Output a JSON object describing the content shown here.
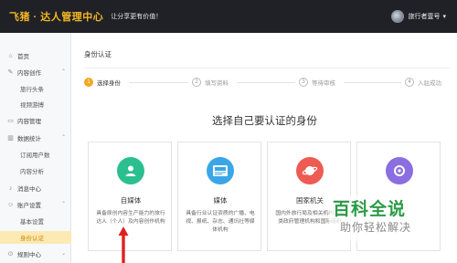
{
  "topbar": {
    "brand": "飞猪 · 达人管理中心",
    "slogan": "让分享更有价值！",
    "username": "旅行者壹号",
    "brand_color": "#f5b623",
    "bg_color": "#1f2127"
  },
  "sidebar": {
    "items": [
      {
        "label": "首页",
        "type": "group",
        "icon": "home-icon"
      },
      {
        "label": "内容创作",
        "type": "group",
        "icon": "edit-icon"
      },
      {
        "label": "旅行头条",
        "type": "child"
      },
      {
        "label": "视频游搏",
        "type": "child"
      },
      {
        "label": "内容管理",
        "type": "group",
        "icon": "folder-icon"
      },
      {
        "label": "数据统计",
        "type": "group",
        "icon": "chart-icon"
      },
      {
        "label": "订阅用户数",
        "type": "child"
      },
      {
        "label": "内容分析",
        "type": "child"
      },
      {
        "label": "消息中心",
        "type": "group",
        "icon": "bell-icon"
      },
      {
        "label": "账户设置",
        "type": "group",
        "icon": "user-icon"
      },
      {
        "label": "基本设置",
        "type": "child"
      },
      {
        "label": "身份认证",
        "type": "child",
        "active": true
      },
      {
        "label": "规则中心",
        "type": "group",
        "icon": "rules-icon"
      }
    ]
  },
  "main": {
    "page_title": "身份认证",
    "steps": [
      {
        "num": "1",
        "label": "选择身份"
      },
      {
        "num": "2",
        "label": "填写资料"
      },
      {
        "num": "3",
        "label": "等待审核"
      },
      {
        "num": "4",
        "label": "入驻成功"
      }
    ],
    "heading": "选择自己要认证的身份",
    "cards": [
      {
        "title": "自媒体",
        "desc": "具备原创内容生产能力的旅行达人（个人）及内容创作机构",
        "icon": "person-icon",
        "color": "#2bbf8f"
      },
      {
        "title": "媒体",
        "desc": "具备行业认证资质的广播、电视、报纸、杂志、通讯社等媒体机构",
        "icon": "new-badge-icon",
        "color": "#3aa6e8"
      },
      {
        "title": "国家机关",
        "desc": "国内外旅行局及相关机构、各类政府管理机构和国际组织",
        "icon": "planet-icon",
        "color": "#ee5b52"
      },
      {
        "title": "",
        "desc": "",
        "icon": "ring-icon",
        "color": "#8b6ee0"
      }
    ]
  },
  "watermark": {
    "title": "百科全说",
    "subtitle": "助你轻松解决"
  }
}
